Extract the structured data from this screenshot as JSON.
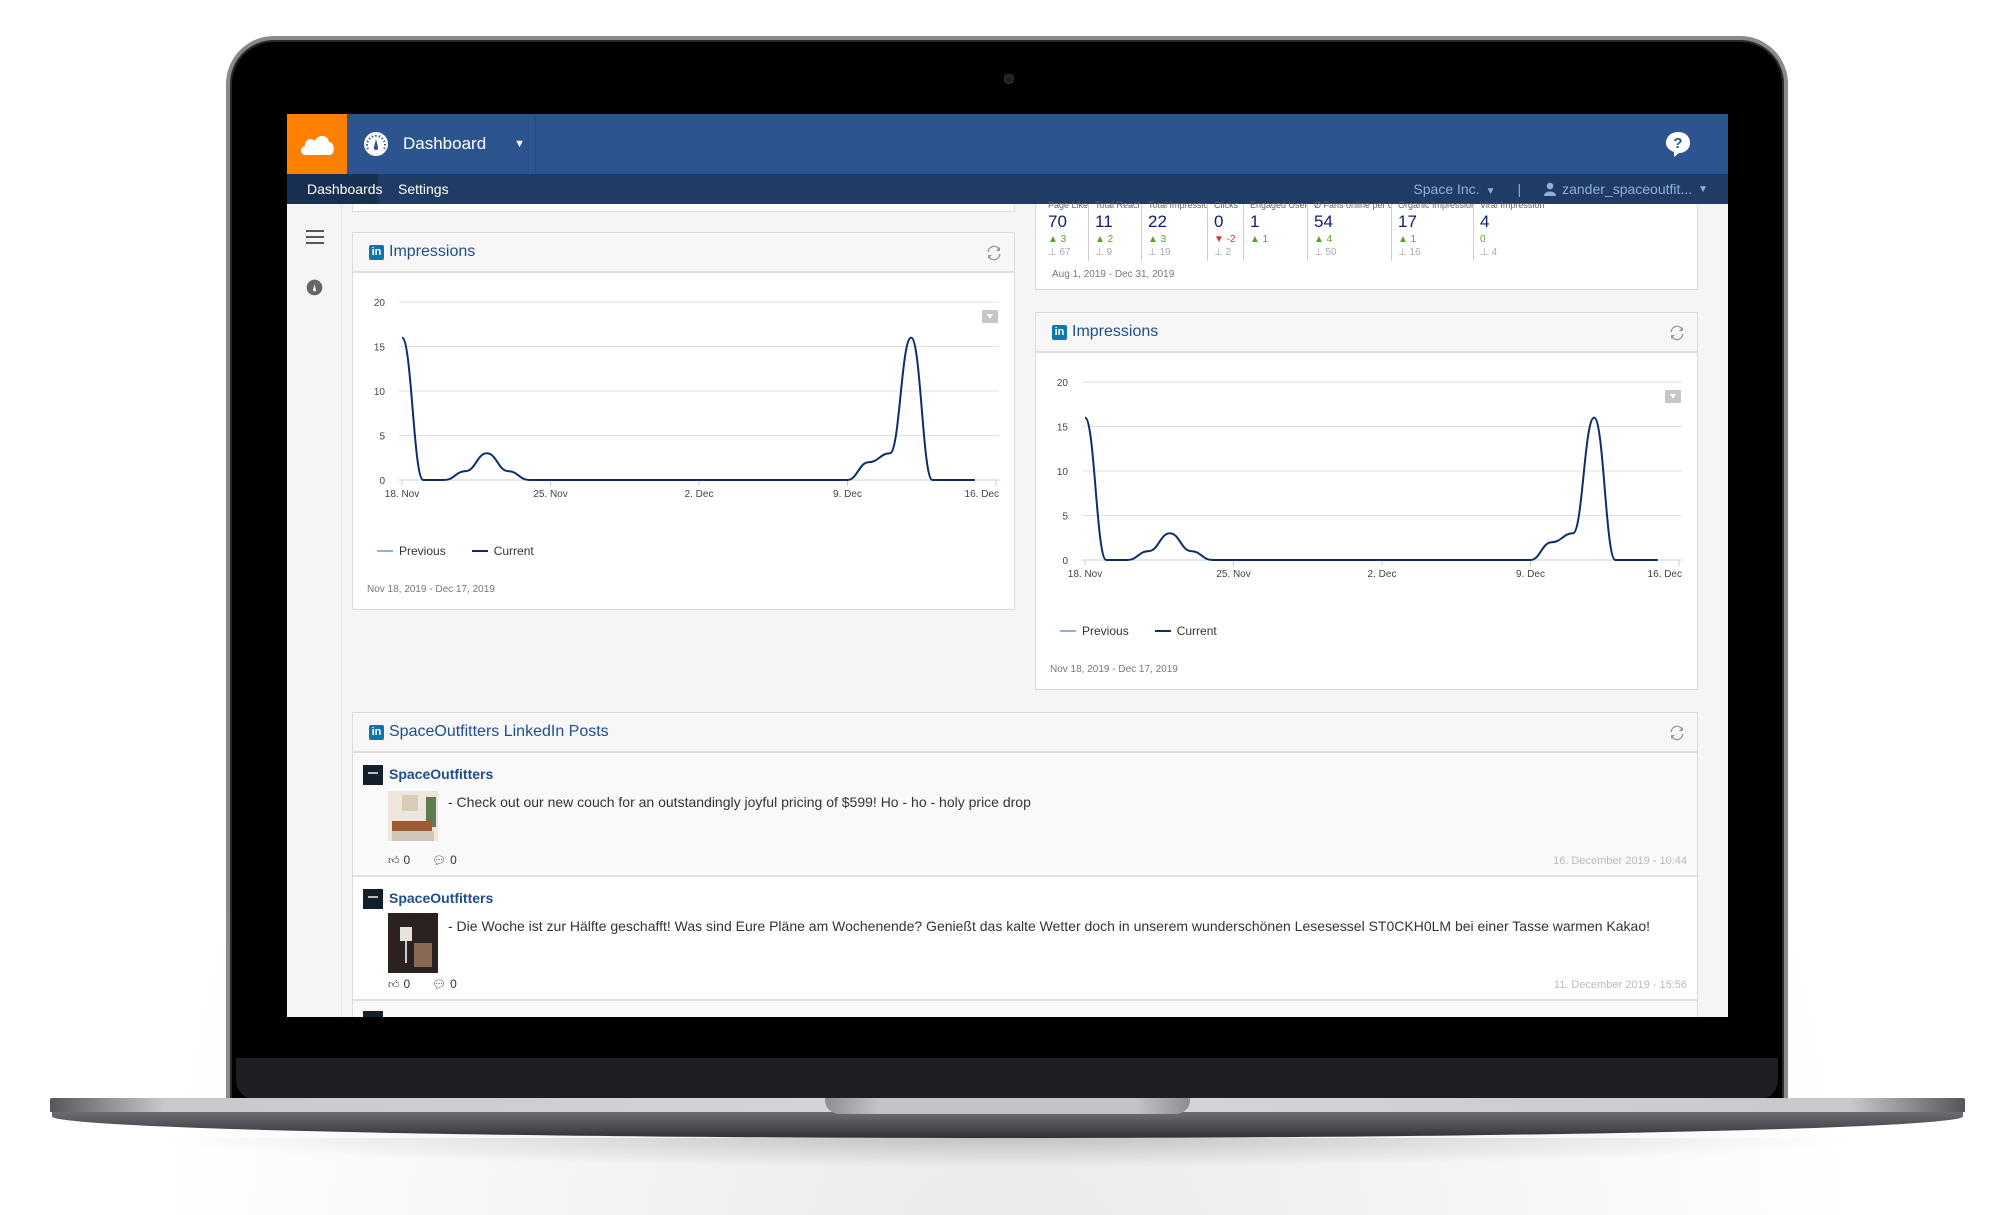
{
  "app": {
    "section_title": "Dashboard",
    "nav_tabs": [
      {
        "label": "Dashboards",
        "active": true
      },
      {
        "label": "Settings",
        "active": false
      }
    ],
    "company": "Space Inc.",
    "user": "zander_spaceoutfit...",
    "separator": "|",
    "colors": {
      "brand_orange": "#ff7f00",
      "header_blue": "#2c558f",
      "subnav_blue": "#1f3c64",
      "linkedin_blue": "#0e76a8",
      "positive": "#5aa02c",
      "negative": "#e03030",
      "series_current": "#0d2d6b",
      "series_previous": "#8fb0d8"
    }
  },
  "stats": {
    "items": [
      {
        "label": "Page Likes",
        "value": "70",
        "change": "3",
        "direction": "up",
        "previous": "67"
      },
      {
        "label": "Total Reach",
        "value": "11",
        "change": "2",
        "direction": "up",
        "previous": "9"
      },
      {
        "label": "Total Impressions",
        "value": "22",
        "change": "3",
        "direction": "up",
        "previous": "19"
      },
      {
        "label": "Clicks",
        "value": "0",
        "change": "-2",
        "direction": "down",
        "previous": "2"
      },
      {
        "label": "Engaged Users",
        "value": "1",
        "change": "1",
        "direction": "up",
        "previous": ""
      },
      {
        "label": "Ø Fans online per day",
        "value": "54",
        "change": "4",
        "direction": "up",
        "previous": "50"
      },
      {
        "label": "Organic Impressions",
        "value": "17",
        "change": "1",
        "direction": "up",
        "previous": "16"
      },
      {
        "label": "Viral Impressions",
        "value": "4",
        "change": "0",
        "direction": "none",
        "previous": "4"
      }
    ],
    "date_range": "Aug 1, 2019 - Dec 31, 2019"
  },
  "chart_data": [
    {
      "type": "line",
      "title": "Impressions",
      "xlabel": "",
      "ylabel": "",
      "ylim": [
        0,
        20
      ],
      "yticks": [
        0,
        5,
        10,
        15,
        20
      ],
      "xtick_labels": [
        "18. Nov",
        "25. Nov",
        "2. Dec",
        "9. Dec",
        "16. Dec"
      ],
      "x": [
        "18. Nov",
        "19. Nov",
        "20. Nov",
        "21. Nov",
        "22. Nov",
        "23. Nov",
        "24. Nov",
        "25. Nov",
        "26. Nov",
        "27. Nov",
        "28. Nov",
        "29. Nov",
        "30. Nov",
        "1. Dec",
        "2. Dec",
        "3. Dec",
        "4. Dec",
        "5. Dec",
        "6. Dec",
        "7. Dec",
        "8. Dec",
        "9. Dec",
        "10. Dec",
        "11. Dec",
        "12. Dec",
        "13. Dec",
        "14. Dec",
        "15. Dec"
      ],
      "series": [
        {
          "name": "Previous",
          "values": []
        },
        {
          "name": "Current",
          "values": [
            16,
            0,
            0,
            1,
            3,
            1,
            0,
            0,
            0,
            0,
            0,
            0,
            0,
            0,
            0,
            0,
            0,
            0,
            0,
            0,
            0,
            0,
            2,
            3,
            16,
            0,
            0,
            0
          ]
        }
      ],
      "grid": true,
      "legend": "bottom-left",
      "date_range": "Nov 18, 2019 - Dec 17, 2019"
    },
    {
      "type": "line",
      "title": "Impressions",
      "xlabel": "",
      "ylabel": "",
      "ylim": [
        0,
        20
      ],
      "yticks": [
        0,
        5,
        10,
        15,
        20
      ],
      "xtick_labels": [
        "18. Nov",
        "25. Nov",
        "2. Dec",
        "9. Dec",
        "16. Dec"
      ],
      "x": [
        "18. Nov",
        "19. Nov",
        "20. Nov",
        "21. Nov",
        "22. Nov",
        "23. Nov",
        "24. Nov",
        "25. Nov",
        "26. Nov",
        "27. Nov",
        "28. Nov",
        "29. Nov",
        "30. Nov",
        "1. Dec",
        "2. Dec",
        "3. Dec",
        "4. Dec",
        "5. Dec",
        "6. Dec",
        "7. Dec",
        "8. Dec",
        "9. Dec",
        "10. Dec",
        "11. Dec",
        "12. Dec",
        "13. Dec",
        "14. Dec",
        "15. Dec"
      ],
      "series": [
        {
          "name": "Previous",
          "values": []
        },
        {
          "name": "Current",
          "values": [
            16,
            0,
            0,
            1,
            3,
            1,
            0,
            0,
            0,
            0,
            0,
            0,
            0,
            0,
            0,
            0,
            0,
            0,
            0,
            0,
            0,
            0,
            2,
            3,
            16,
            0,
            0,
            0
          ]
        }
      ],
      "grid": true,
      "legend": "bottom-left",
      "date_range": "Nov 18, 2019 - Dec 17, 2019"
    }
  ],
  "posts": {
    "title": "SpaceOutfitters LinkedIn Posts",
    "items": [
      {
        "author": "SpaceOutfitters",
        "text": "- Check out our new couch for an outstandingly joyful pricing of $599! Ho - ho - holy price drop",
        "likes": "0",
        "comments": "0",
        "timestamp": "16. December 2019 - 10:44"
      },
      {
        "author": "SpaceOutfitters",
        "text": "- Die Woche ist zur Hälfte geschafft! Was sind Eure Pläne am Wochenende? Genießt das kalte Wetter doch in unserem wunderschönen Lesesessel ST0CKH0LM bei einer Tasse warmen Kakao!",
        "likes": "0",
        "comments": "0",
        "timestamp": "11. December 2019 - 15:56"
      }
    ]
  }
}
